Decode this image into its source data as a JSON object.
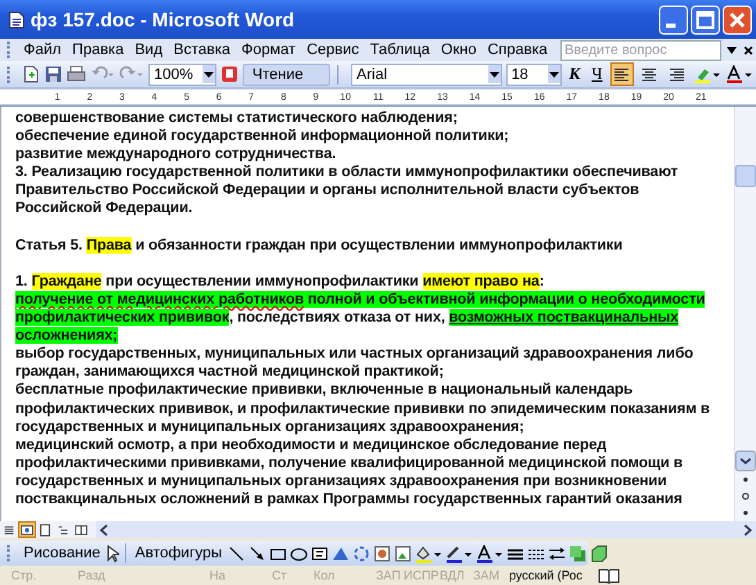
{
  "window": {
    "title": "фз 157.doc - Microsoft Word"
  },
  "menu": [
    "Файл",
    "Правка",
    "Вид",
    "Вставка",
    "Формат",
    "Сервис",
    "Таблица",
    "Окно",
    "Справка"
  ],
  "help_field": {
    "placeholder": "Введите вопрос"
  },
  "toolbar": {
    "zoom": "100%",
    "reading": "Чтение",
    "font": "Arial",
    "size": "18",
    "italic_label": "К",
    "underline_label": "Ч",
    "align": [
      {
        "kind": "left",
        "selected": true
      },
      {
        "kind": "center",
        "selected": false
      },
      {
        "kind": "right",
        "selected": false
      }
    ]
  },
  "ruler": [
    "1",
    "2",
    "3",
    "4",
    "5",
    "6",
    "7",
    "8",
    "9",
    "10",
    "11",
    "12",
    "13",
    "14",
    "15",
    "16",
    "17",
    "18",
    "19",
    "20",
    "21"
  ],
  "document": {
    "paragraphs": [
      {
        "lines": [
          [
            {
              "text": "совершенствование системы статистического наблюдения;",
              "highlighted": false,
              "spelling_error": false,
              "underlined": false
            }
          ],
          [
            {
              "text": "обеспечение единой государственной информационной политики;",
              "highlighted": false,
              "spelling_error": false,
              "underlined": false
            }
          ],
          [
            {
              "text": "развитие международного сотрудничества.",
              "highlighted": false,
              "spelling_error": false,
              "underlined": false
            }
          ],
          [
            {
              "text": "3. Реализацию государственной политики в области иммунопрофилактики обеспечивают",
              "highlighted": false,
              "spelling_error": false,
              "underlined": false
            }
          ],
          [
            {
              "text": "Правительство Российской Федерации и органы исполнительной власти субъектов",
              "highlighted": false,
              "spelling_error": false,
              "underlined": false
            }
          ],
          [
            {
              "text": "Российской Федерации.",
              "highlighted": false,
              "spelling_error": false,
              "underlined": false
            }
          ]
        ]
      },
      {
        "lines": [
          [
            {
              "text": "Статья 5. ",
              "highlighted": false,
              "spelling_error": false,
              "underlined": false
            },
            {
              "text": "Права",
              "highlighted": true,
              "color": "#ffff00",
              "spelling_error": false,
              "underlined": false
            },
            {
              "text": " и обязанности граждан при осуществлении иммунопрофилактики",
              "highlighted": false,
              "spelling_error": false,
              "underlined": false
            }
          ]
        ]
      },
      {
        "lines": [
          [
            {
              "text": "1. ",
              "highlighted": false,
              "spelling_error": false,
              "underlined": false
            },
            {
              "text": "Граждане",
              "highlighted": true,
              "color": "#ffff00",
              "spelling_error": false,
              "underlined": false
            },
            {
              "text": " при осуществлении иммунопрофилактики ",
              "highlighted": false,
              "spelling_error": false,
              "underlined": false
            },
            {
              "text": "имеют право на",
              "highlighted": true,
              "color": "#ffff00",
              "spelling_error": false,
              "underlined": false
            },
            {
              "text": ":",
              "highlighted": false,
              "spelling_error": false,
              "underlined": false
            }
          ],
          [
            {
              "text": "получение от медицинских работников",
              "highlighted": true,
              "color": "#00ff00",
              "spelling_error": true,
              "underlined": false
            },
            {
              "text": " полной и объективной информации о необходимости",
              "highlighted": true,
              "color": "#00ff00",
              "spelling_error": false,
              "underlined": false
            }
          ],
          [
            {
              "text": "профилактических прививок",
              "highlighted": true,
              "color": "#00ff00",
              "spelling_error": false,
              "underlined": false
            },
            {
              "text": ", последствиях отказа от них, ",
              "highlighted": false,
              "spelling_error": false,
              "underlined": false
            },
            {
              "text": "возможных поствакцинальных",
              "highlighted": true,
              "color": "#00ff00",
              "spelling_error": false,
              "underlined": true
            }
          ],
          [
            {
              "text": "осложнениях;",
              "highlighted": true,
              "color": "#00ff00",
              "spelling_error": false,
              "underlined": false
            }
          ],
          [
            {
              "text": "выбор государственных, муниципальных или частных организаций здравоохранения либо",
              "highlighted": false,
              "spelling_error": false,
              "underlined": false
            }
          ],
          [
            {
              "text": "граждан, занимающихся частной медицинской практикой;",
              "highlighted": false,
              "spelling_error": false,
              "underlined": false
            }
          ],
          [
            {
              "text": "бесплатные профилактические прививки, включенные в национальный календарь",
              "highlighted": false,
              "spelling_error": false,
              "underlined": false
            }
          ],
          [
            {
              "text": "профилактических прививок, и профилактические прививки по эпидемическим показаниям в",
              "highlighted": false,
              "spelling_error": false,
              "underlined": false
            }
          ],
          [
            {
              "text": "государственных и муниципальных организациях здравоохранения;",
              "highlighted": false,
              "spelling_error": false,
              "underlined": false
            }
          ],
          [
            {
              "text": "медицинский осмотр, а при необходимости и медицинское обследование перед",
              "highlighted": false,
              "spelling_error": false,
              "underlined": false
            }
          ],
          [
            {
              "text": "профилактическими прививками, получение квалифицированной медицинской помощи в",
              "highlighted": false,
              "spelling_error": false,
              "underlined": false
            }
          ],
          [
            {
              "text": "государственных и муниципальных организациях здравоохранения при возникновении",
              "highlighted": false,
              "spelling_error": false,
              "underlined": false
            }
          ],
          [
            {
              "text": "поствакцинальных осложнений в рамках Программы государственных гарантий оказания",
              "highlighted": false,
              "spelling_error": false,
              "underlined": false
            }
          ]
        ]
      }
    ]
  },
  "views": [
    {
      "kind": "normal",
      "selected": false
    },
    {
      "kind": "web",
      "selected": true
    },
    {
      "kind": "print",
      "selected": false
    },
    {
      "kind": "outline",
      "selected": false
    },
    {
      "kind": "reading",
      "selected": false
    }
  ],
  "drawing_toolbar": {
    "drawing": "Рисование",
    "autoshapes": "Автофигуры"
  },
  "status_bar": [
    {
      "text": "Стр.",
      "disabled": true
    },
    {
      "text": "Разд",
      "disabled": true
    },
    {
      "text": "На",
      "disabled": true
    },
    {
      "text": "Ст",
      "disabled": true
    },
    {
      "text": "Кол",
      "disabled": true
    },
    {
      "text": "ЗАП",
      "disabled": true
    },
    {
      "text": "ИСПР",
      "disabled": true
    },
    {
      "text": "ВДЛ",
      "disabled": true
    },
    {
      "text": "ЗАМ",
      "disabled": true
    },
    {
      "text": "русский (Рос",
      "disabled": false
    }
  ]
}
